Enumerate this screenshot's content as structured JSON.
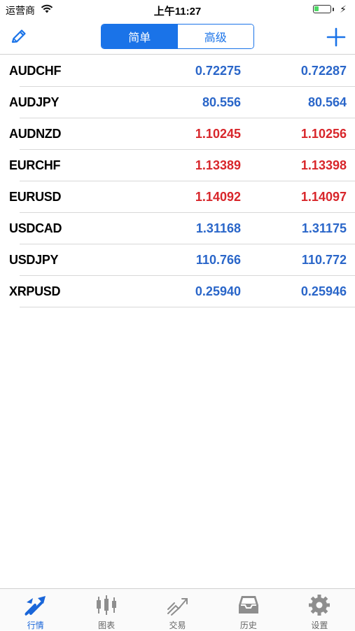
{
  "status_bar": {
    "carrier": "运营商",
    "time": "上午11:27"
  },
  "nav": {
    "segments": [
      "简单",
      "高级"
    ],
    "selected": "简单"
  },
  "quotes": [
    {
      "symbol": "AUDCHF",
      "bid": "0.72275",
      "ask": "0.72287",
      "color": "#2a66c9"
    },
    {
      "symbol": "AUDJPY",
      "bid": "80.556",
      "ask": "80.564",
      "color": "#2a66c9"
    },
    {
      "symbol": "AUDNZD",
      "bid": "1.10245",
      "ask": "1.10256",
      "color": "#d8262b"
    },
    {
      "symbol": "EURCHF",
      "bid": "1.13389",
      "ask": "1.13398",
      "color": "#d8262b"
    },
    {
      "symbol": "EURUSD",
      "bid": "1.14092",
      "ask": "1.14097",
      "color": "#d8262b"
    },
    {
      "symbol": "USDCAD",
      "bid": "1.31168",
      "ask": "1.31175",
      "color": "#2a66c9"
    },
    {
      "symbol": "USDJPY",
      "bid": "110.766",
      "ask": "110.772",
      "color": "#2a66c9"
    },
    {
      "symbol": "XRPUSD",
      "bid": "0.25940",
      "ask": "0.25946",
      "color": "#2a66c9"
    }
  ],
  "tabs": [
    {
      "label": "行情",
      "icon": "quotes-icon",
      "active": true
    },
    {
      "label": "图表",
      "icon": "chart-icon",
      "active": false
    },
    {
      "label": "交易",
      "icon": "trade-icon",
      "active": false
    },
    {
      "label": "历史",
      "icon": "history-icon",
      "active": false
    },
    {
      "label": "设置",
      "icon": "settings-icon",
      "active": false
    }
  ],
  "colors": {
    "accent": "#1a73e8",
    "up": "#2a66c9",
    "down": "#d8262b",
    "inactive_tab": "#8e8e8e"
  }
}
